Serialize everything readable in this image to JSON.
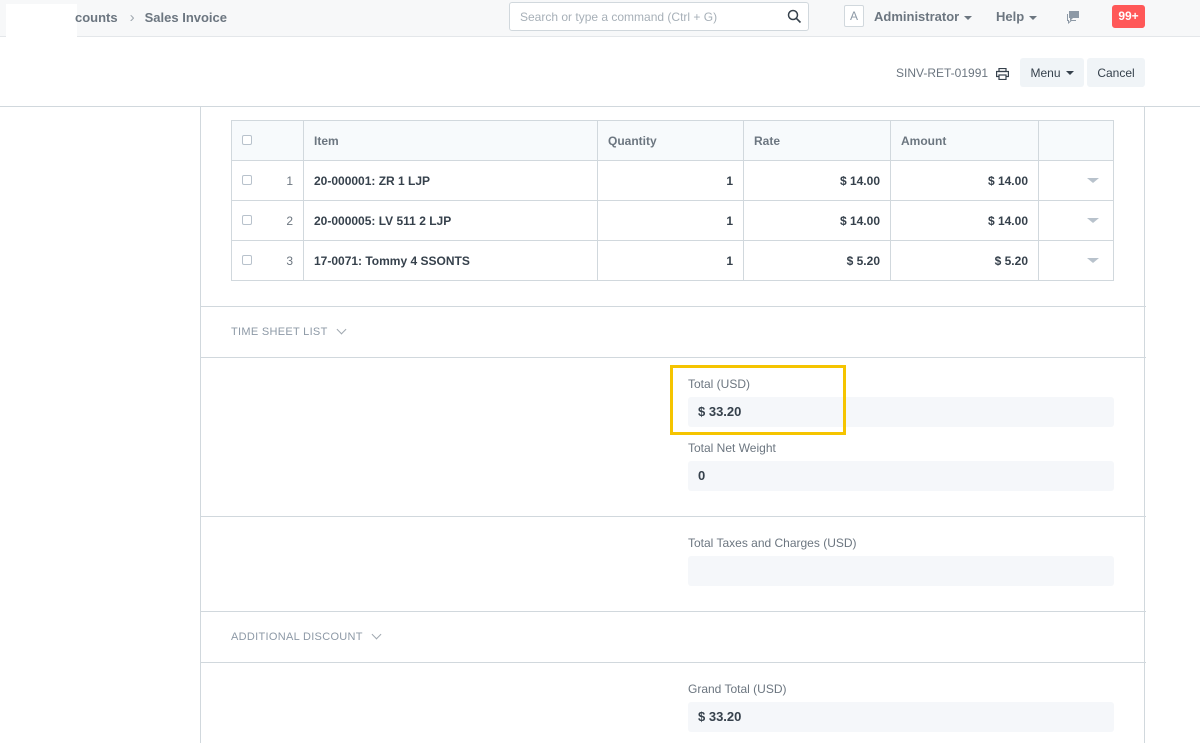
{
  "navbar": {
    "breadcrumbs": [
      "counts",
      "Sales Invoice"
    ],
    "search_placeholder": "Search or type a command (Ctrl + G)",
    "avatar_letter": "A",
    "user_label": "Administrator",
    "help_label": "Help",
    "notification_count": "99+"
  },
  "page_head": {
    "doc_name": "SINV-RET-01991",
    "menu_label": "Menu",
    "cancel_label": "Cancel"
  },
  "items_table": {
    "headers": {
      "item": "Item",
      "quantity": "Quantity",
      "rate": "Rate",
      "amount": "Amount"
    },
    "rows": [
      {
        "idx": "1",
        "item": "20-000001: ZR 1 LJP",
        "quantity": "1",
        "rate": "$ 14.00",
        "amount": "$ 14.00"
      },
      {
        "idx": "2",
        "item": "20-000005: LV 511 2 LJP",
        "quantity": "1",
        "rate": "$ 14.00",
        "amount": "$ 14.00"
      },
      {
        "idx": "3",
        "item": "17-0071: Tommy 4 SSONTS",
        "quantity": "1",
        "rate": "$ 5.20",
        "amount": "$ 5.20"
      }
    ]
  },
  "sections": {
    "time_sheet": "TIME SHEET LIST",
    "additional_discount": "ADDITIONAL DISCOUNT"
  },
  "fields": {
    "total_label": "Total (USD)",
    "total_value": "$ 33.20",
    "net_weight_label": "Total Net Weight",
    "net_weight_value": "0",
    "taxes_label": "Total Taxes and Charges (USD)",
    "taxes_value": "",
    "grand_total_label": "Grand Total (USD)",
    "grand_total_value": "$ 33.20"
  },
  "colors": {
    "highlight": "#f5c400",
    "notification": "#ff5858"
  }
}
